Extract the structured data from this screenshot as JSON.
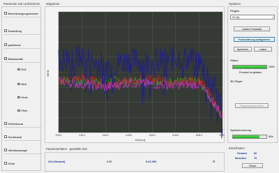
{
  "param_panel": {
    "title": "Parameter zum aufzeichnen",
    "items": [
      {
        "label": "Beschleunigungsmesser",
        "checked": false
      },
      {
        "label": "Einstellung",
        "checked": false
      },
      {
        "label": "gasklemal",
        "checked": false
      },
      {
        "label": "Basiskanäle",
        "checked": true
      },
      {
        "label": "Höhenkanal",
        "checked": false
      },
      {
        "label": "Sonikkanal",
        "checked": false
      },
      {
        "label": "Vibrationspegel",
        "checked": false
      },
      {
        "label": "Höhe",
        "checked": false
      }
    ],
    "subitems": [
      {
        "label": "Roll",
        "checked": true,
        "color": "#22aa22"
      },
      {
        "label": "Nick",
        "checked": true,
        "color": "#cc33cc"
      },
      {
        "label": "Heck",
        "checked": true,
        "color": "#cc2222"
      },
      {
        "label": "Pitch",
        "checked": true,
        "color": "#1a1a9a"
      }
    ]
  },
  "diagram": {
    "title": "Diagramm",
    "ylabel": "Werte",
    "xlabel": "Zeit [m:s]",
    "xticks": [
      "0:00.0",
      "1:20.0",
      "2:40.0",
      "4:00.0",
      "5:20.0",
      "6:40.0",
      "8:00.0",
      "9:20.0"
    ],
    "plot_bg": "#353a35"
  },
  "chart_data": {
    "type": "line",
    "xlabel": "Zeit [m:s]",
    "ylabel": "Werte",
    "x": [
      "0:00.0",
      "1:20.0",
      "2:40.0",
      "4:00.0",
      "5:20.0",
      "6:40.0",
      "8:00.0",
      "9:20.0"
    ],
    "series": [
      {
        "name": "Pitch",
        "color": "#1a1a9a",
        "values": [
          1.2,
          1.25,
          1.1,
          1.2,
          1.15,
          1.25,
          1.2,
          0.5
        ]
      },
      {
        "name": "Heck",
        "color": "#cc2222",
        "values": [
          0.85,
          0.9,
          0.8,
          0.85,
          0.9,
          0.8,
          0.88,
          0.3
        ]
      },
      {
        "name": "Nick",
        "color": "#cc33cc",
        "values": [
          0.85,
          0.8,
          0.75,
          0.82,
          0.8,
          0.78,
          0.8,
          0.3
        ]
      },
      {
        "name": "Roll",
        "color": "#22aa22",
        "values": [
          0.88,
          0.85,
          0.86,
          0.84,
          0.86,
          0.85,
          0.84,
          0.3
        ]
      }
    ],
    "grid": true
  },
  "bottom": {
    "title": "Parameterdaten - gewählte Zeit",
    "zeit_label": "Zeit (Gesamt)",
    "value1": "0.00",
    "value2": "9:22.399"
  },
  "options": {
    "title": "Optionen",
    "plugins_label": "Plugins",
    "plugin_value": "2D-fig",
    "btn_delete": "Lösche Protokolle",
    "btn_config": "Protokollierung konfigurieren",
    "btn_save": "Speichern",
    "btn_load": "Laden",
    "status_label": "Status",
    "status_percent": "100%",
    "status_fraction": 1.0,
    "status_text": "Protokoll ist geladen",
    "player_label": "3D-Player",
    "player_btn": "Flugbewegung öffnen",
    "memory_label": "Speichernutzung",
    "memory_percent": "80%",
    "memory_fraction": 0.8
  },
  "counts": {
    "title": "Einzelheiten",
    "gesamt_label": "Gesamt",
    "gesamt_value": "82",
    "benutzer_label": "Benutzer",
    "benutzer_value": "76",
    "reset_label": "Reset"
  }
}
